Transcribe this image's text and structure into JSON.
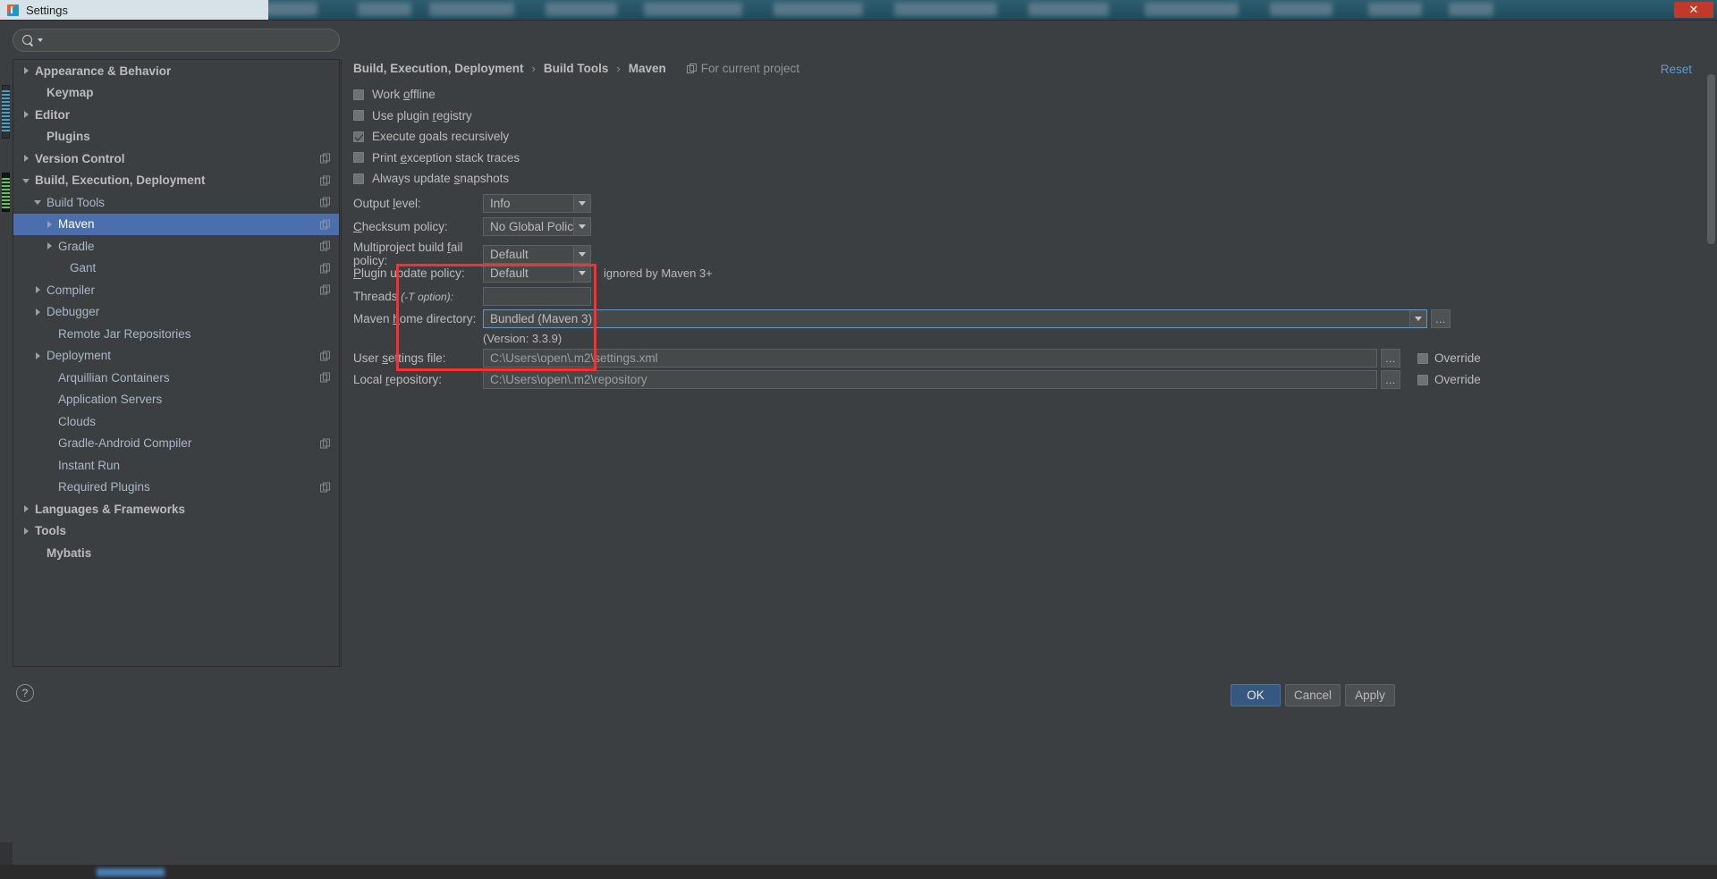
{
  "window": {
    "title": "Settings",
    "logo_icon": "intellij-logo-icon",
    "close_label": "✕"
  },
  "search": {
    "value": "",
    "placeholder": "",
    "icon": "search-icon",
    "dropdown_icon": "chevron-down-icon"
  },
  "sidebar": {
    "items": [
      {
        "label": "Appearance & Behavior",
        "indent": 0,
        "arrow": "right",
        "bold": true,
        "selected": false,
        "badge": false
      },
      {
        "label": "Keymap",
        "indent": 1,
        "arrow": "none",
        "bold": true,
        "selected": false,
        "badge": false
      },
      {
        "label": "Editor",
        "indent": 0,
        "arrow": "right",
        "bold": true,
        "selected": false,
        "badge": false
      },
      {
        "label": "Plugins",
        "indent": 1,
        "arrow": "none",
        "bold": true,
        "selected": false,
        "badge": false
      },
      {
        "label": "Version Control",
        "indent": 0,
        "arrow": "right",
        "bold": true,
        "selected": false,
        "badge": true
      },
      {
        "label": "Build, Execution, Deployment",
        "indent": 0,
        "arrow": "down",
        "bold": true,
        "selected": false,
        "badge": true
      },
      {
        "label": "Build Tools",
        "indent": 1,
        "arrow": "down",
        "bold": false,
        "selected": false,
        "badge": true
      },
      {
        "label": "Maven",
        "indent": 2,
        "arrow": "right",
        "bold": false,
        "selected": true,
        "badge": true
      },
      {
        "label": "Gradle",
        "indent": 2,
        "arrow": "right",
        "bold": false,
        "selected": false,
        "badge": true
      },
      {
        "label": "Gant",
        "indent": 3,
        "arrow": "none",
        "bold": false,
        "selected": false,
        "badge": true
      },
      {
        "label": "Compiler",
        "indent": 1,
        "arrow": "right",
        "bold": false,
        "selected": false,
        "badge": true
      },
      {
        "label": "Debugger",
        "indent": 1,
        "arrow": "right",
        "bold": false,
        "selected": false,
        "badge": false
      },
      {
        "label": "Remote Jar Repositories",
        "indent": 2,
        "arrow": "none",
        "bold": false,
        "selected": false,
        "badge": false
      },
      {
        "label": "Deployment",
        "indent": 1,
        "arrow": "right",
        "bold": false,
        "selected": false,
        "badge": true
      },
      {
        "label": "Arquillian Containers",
        "indent": 2,
        "arrow": "none",
        "bold": false,
        "selected": false,
        "badge": true
      },
      {
        "label": "Application Servers",
        "indent": 2,
        "arrow": "none",
        "bold": false,
        "selected": false,
        "badge": false
      },
      {
        "label": "Clouds",
        "indent": 2,
        "arrow": "none",
        "bold": false,
        "selected": false,
        "badge": false
      },
      {
        "label": "Gradle-Android Compiler",
        "indent": 2,
        "arrow": "none",
        "bold": false,
        "selected": false,
        "badge": true
      },
      {
        "label": "Instant Run",
        "indent": 2,
        "arrow": "none",
        "bold": false,
        "selected": false,
        "badge": false
      },
      {
        "label": "Required Plugins",
        "indent": 2,
        "arrow": "none",
        "bold": false,
        "selected": false,
        "badge": true
      },
      {
        "label": "Languages & Frameworks",
        "indent": 0,
        "arrow": "right",
        "bold": true,
        "selected": false,
        "badge": false
      },
      {
        "label": "Tools",
        "indent": 0,
        "arrow": "right",
        "bold": true,
        "selected": false,
        "badge": false
      },
      {
        "label": "Mybatis",
        "indent": 1,
        "arrow": "none",
        "bold": true,
        "selected": false,
        "badge": false
      }
    ]
  },
  "breadcrumb": {
    "parts": [
      "Build, Execution, Deployment",
      "Build Tools",
      "Maven"
    ],
    "separator": "›",
    "scope_label": "For current project",
    "scope_icon": "copy-scope-icon",
    "reset_label": "Reset"
  },
  "form": {
    "checkboxes": [
      {
        "label_pre": "Work ",
        "label_mnemonic": "o",
        "label_post": "ffline",
        "checked": false
      },
      {
        "label_pre": "Use plugin ",
        "label_mnemonic": "r",
        "label_post": "egistry",
        "checked": false
      },
      {
        "label_pre": "Execute ",
        "label_mnemonic": "g",
        "label_post": "oals recursively",
        "checked": true
      },
      {
        "label_pre": "Print ",
        "label_mnemonic": "e",
        "label_post": "xception stack traces",
        "checked": false
      },
      {
        "label_pre": "Always update ",
        "label_mnemonic": "s",
        "label_post": "napshots",
        "checked": false
      }
    ],
    "output_level": {
      "label_pre": "Output ",
      "label_mnemonic": "l",
      "label_post": "evel:",
      "value": "Info"
    },
    "checksum_policy": {
      "label_pre": "",
      "label_mnemonic": "C",
      "label_post": "hecksum policy:",
      "value": "No Global Policy"
    },
    "multiproject_fail_policy": {
      "label_pre": "Multiproject build ",
      "label_mnemonic": "f",
      "label_post": "ail policy:",
      "value": "Default"
    },
    "plugin_update_policy": {
      "label_pre": "",
      "label_mnemonic": "P",
      "label_post": "lugin update policy:",
      "value": "Default",
      "note": "ignored by Maven 3+"
    },
    "threads": {
      "label": "Threads",
      "hint": "(-T option):",
      "value": ""
    },
    "maven_home": {
      "label_pre": "Maven ",
      "label_mnemonic": "h",
      "label_post": "ome directory:",
      "value": "Bundled (Maven 3)",
      "version_note": "(Version: 3.3.9)",
      "browse_label": "..."
    },
    "user_settings_file": {
      "label_pre": "User ",
      "label_mnemonic": "s",
      "label_post": "ettings file:",
      "value": "C:\\Users\\open\\.m2\\settings.xml",
      "browse_label": "...",
      "override_label": "Override",
      "override_checked": false
    },
    "local_repository": {
      "label_pre": "Local ",
      "label_mnemonic": "r",
      "label_post": "epository:",
      "value": "C:\\Users\\open\\.m2\\repository",
      "browse_label": "...",
      "override_label": "Override",
      "override_checked": false
    }
  },
  "footer": {
    "help_label": "?",
    "ok_label": "OK",
    "cancel_label": "Cancel",
    "apply_label": "Apply"
  },
  "colors": {
    "accent_selection": "#4b6eaf",
    "link": "#5b9bd5",
    "highlight_rect": "#ff2e2e",
    "primary_button": "#365880",
    "panel_bg": "#3c3f41",
    "field_bg": "#45494a"
  }
}
